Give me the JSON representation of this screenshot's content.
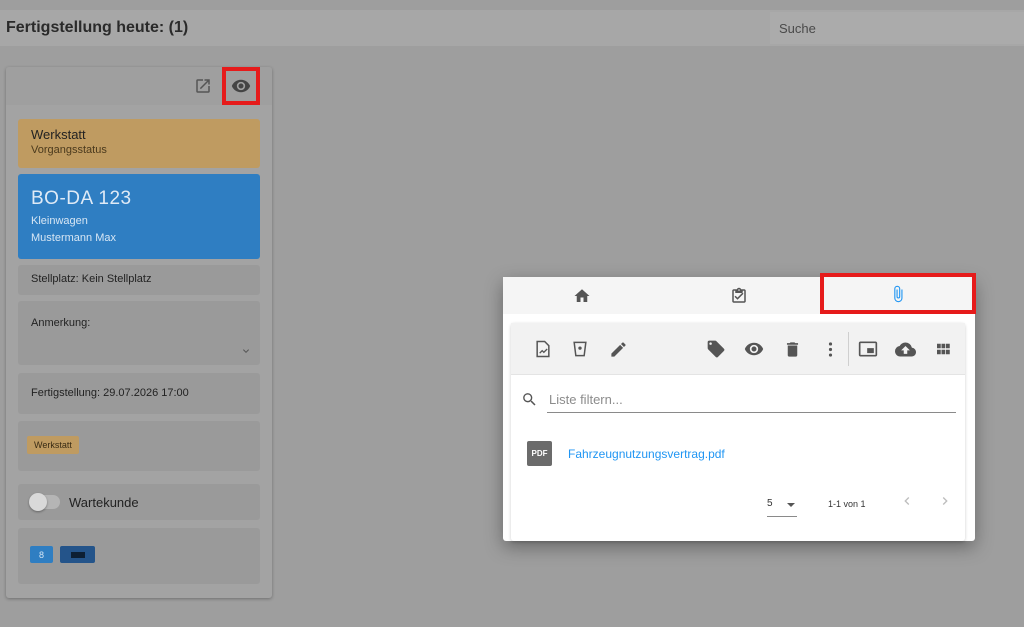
{
  "header": {
    "title": "Fertigstellung heute: (1)",
    "search_placeholder": "Suche"
  },
  "card": {
    "status": {
      "title": "Werkstatt",
      "subtitle": "Vorgangsstatus",
      "color": "#bf9b61"
    },
    "vehicle": {
      "plate": "BO-DA 123",
      "type": "Kleinwagen",
      "owner": "Mustermann Max",
      "color": "#2f7ec2"
    },
    "parking": "Stellplatz: Kein Stellplatz",
    "remark_label": "Anmerkung:",
    "finish": "Fertigstellung: 29.07.2026 17:00",
    "tag": "Werkstatt",
    "toggle_label": "Wartekunde",
    "chip_number": "8"
  },
  "dialog": {
    "tabs": [
      {
        "icon": "home-icon"
      },
      {
        "icon": "clipboard-check-icon"
      },
      {
        "icon": "paperclip-icon",
        "active": true
      }
    ],
    "filter_placeholder": "Liste filtern...",
    "files": [
      {
        "badge": "PDF",
        "name": "Fahrzeugnutzungsvertrag.pdf"
      }
    ],
    "pager": {
      "page_size": "5",
      "range": "1-1 von 1"
    }
  },
  "colors": {
    "highlight": "#e61b1b",
    "link": "#2196f3"
  }
}
